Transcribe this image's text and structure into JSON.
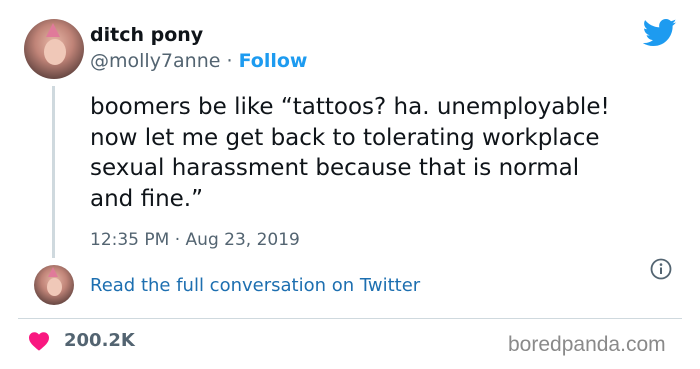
{
  "author": {
    "display_name": "ditch pony",
    "handle": "@molly7anne",
    "separator": " · ",
    "follow_label": "Follow"
  },
  "tweet": {
    "text": "boomers be like “tattoos? ha. unemployable!\nnow let me get back to tolerating workplace\nsexual harassment because that is normal\nand fine.”",
    "time": "12:35 PM",
    "date_separator": " · ",
    "date": "Aug 23, 2019"
  },
  "conversation": {
    "link_text": "Read the full conversation on Twitter"
  },
  "engagement": {
    "likes": "200.2K"
  },
  "watermark": "boredpanda.com",
  "icons": {
    "brand": "twitter-bird-icon",
    "info": "info-icon",
    "like": "heart-icon"
  },
  "colors": {
    "link": "#1d9bf0",
    "heart": "#f91880",
    "secondary_text": "#536471"
  }
}
